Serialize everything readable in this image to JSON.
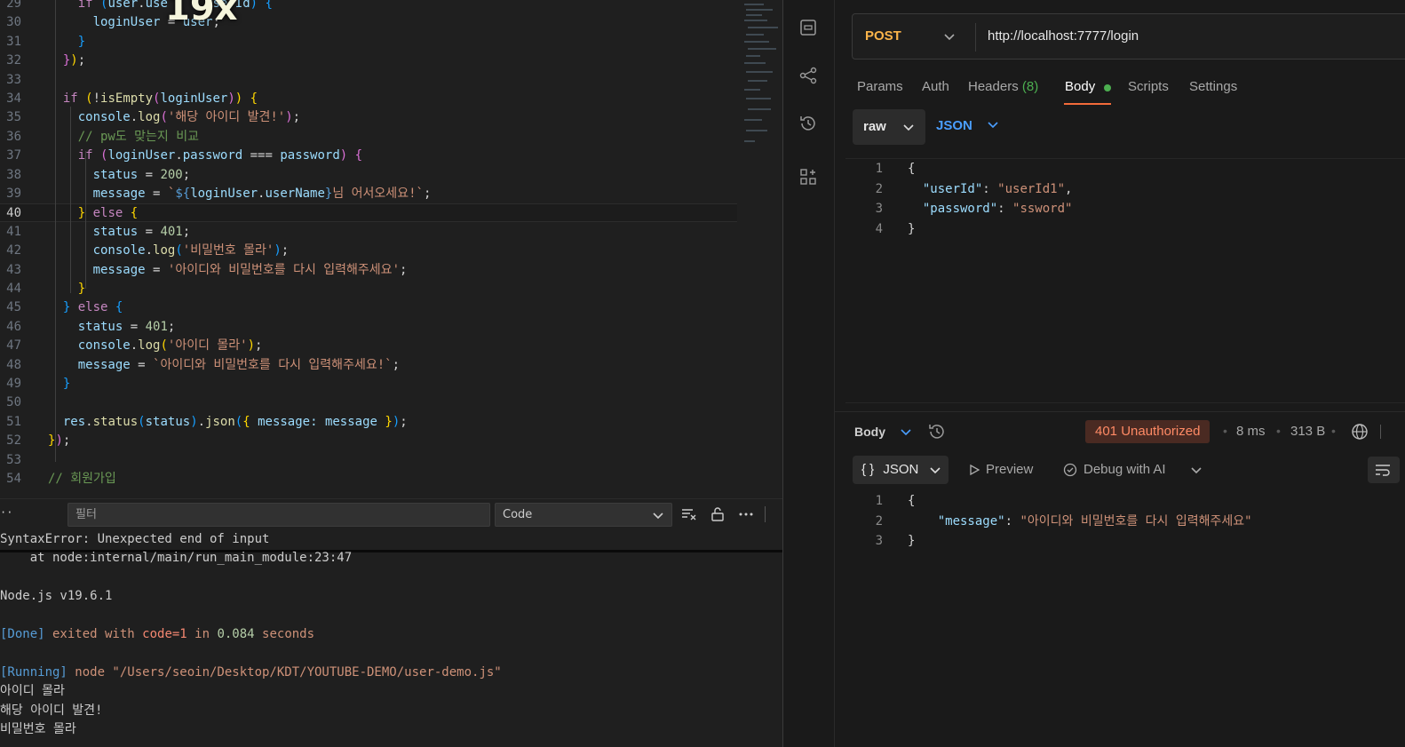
{
  "editor": {
    "overlay_text": "19x",
    "lines": [
      {
        "n": "29",
        "tokens": [
          [
            "    ",
            "pn"
          ],
          [
            "if",
            "kw"
          ],
          [
            " ",
            "pn"
          ],
          [
            "(",
            "b3"
          ],
          [
            "user",
            "var"
          ],
          [
            ".",
            "pn"
          ],
          [
            "use",
            "var"
          ],
          [
            "     ",
            "pn"
          ],
          [
            "userId",
            "var"
          ],
          [
            ")",
            "b3"
          ],
          [
            " ",
            "pn"
          ],
          [
            "{",
            "b3"
          ]
        ]
      },
      {
        "n": "30",
        "tokens": [
          [
            "      ",
            "pn"
          ],
          [
            "loginUser",
            "var"
          ],
          [
            " = ",
            "pn"
          ],
          [
            "user",
            "var"
          ],
          [
            ";",
            "pn"
          ]
        ]
      },
      {
        "n": "31",
        "tokens": [
          [
            "    ",
            "pn"
          ],
          [
            "}",
            "b3"
          ]
        ]
      },
      {
        "n": "32",
        "tokens": [
          [
            "  ",
            "pn"
          ],
          [
            "}",
            "b2"
          ],
          [
            ")",
            "b1"
          ],
          [
            ";",
            "pn"
          ]
        ]
      },
      {
        "n": "33",
        "tokens": []
      },
      {
        "n": "34",
        "tokens": [
          [
            "  ",
            "pn"
          ],
          [
            "if",
            "kw"
          ],
          [
            " ",
            "pn"
          ],
          [
            "(",
            "b1"
          ],
          [
            "!",
            "pn"
          ],
          [
            "isEmpty",
            "fn"
          ],
          [
            "(",
            "b2"
          ],
          [
            "loginUser",
            "var"
          ],
          [
            ")",
            "b2"
          ],
          [
            ")",
            "b1"
          ],
          [
            " ",
            "pn"
          ],
          [
            "{",
            "b1"
          ]
        ]
      },
      {
        "n": "35",
        "tokens": [
          [
            "    ",
            "pn"
          ],
          [
            "console",
            "var"
          ],
          [
            ".",
            "pn"
          ],
          [
            "log",
            "fn"
          ],
          [
            "(",
            "b2"
          ],
          [
            "'해당 아이디 발견!'",
            "str"
          ],
          [
            ")",
            "b2"
          ],
          [
            ";",
            "pn"
          ]
        ]
      },
      {
        "n": "36",
        "tokens": [
          [
            "    ",
            "pn"
          ],
          [
            "// pw도 맞는지 비교",
            "cm"
          ]
        ]
      },
      {
        "n": "37",
        "tokens": [
          [
            "    ",
            "pn"
          ],
          [
            "if",
            "kw"
          ],
          [
            " ",
            "pn"
          ],
          [
            "(",
            "b2"
          ],
          [
            "loginUser",
            "var"
          ],
          [
            ".",
            "pn"
          ],
          [
            "password",
            "var"
          ],
          [
            " === ",
            "pn"
          ],
          [
            "password",
            "var"
          ],
          [
            ")",
            "b2"
          ],
          [
            " ",
            "pn"
          ],
          [
            "{",
            "b2"
          ]
        ]
      },
      {
        "n": "38",
        "tokens": [
          [
            "      ",
            "pn"
          ],
          [
            "status",
            "var"
          ],
          [
            " = ",
            "pn"
          ],
          [
            "200",
            "num"
          ],
          [
            ";",
            "pn"
          ]
        ]
      },
      {
        "n": "39",
        "tokens": [
          [
            "      ",
            "pn"
          ],
          [
            "message",
            "var"
          ],
          [
            " = ",
            "pn"
          ],
          [
            "`",
            "str"
          ],
          [
            "${",
            "tpl"
          ],
          [
            "loginUser",
            "var"
          ],
          [
            ".",
            "pn"
          ],
          [
            "userName",
            "var"
          ],
          [
            "}",
            "tpl"
          ],
          [
            "님 어서오세요!`",
            "str"
          ],
          [
            ";",
            "pn"
          ]
        ]
      },
      {
        "n": "40",
        "current": true,
        "tokens": [
          [
            "    ",
            "pn"
          ],
          [
            "}",
            "b1"
          ],
          [
            " ",
            "pn"
          ],
          [
            "else",
            "kw"
          ],
          [
            " ",
            "pn"
          ],
          [
            "{",
            "b1"
          ]
        ]
      },
      {
        "n": "41",
        "tokens": [
          [
            "      ",
            "pn"
          ],
          [
            "status",
            "var"
          ],
          [
            " = ",
            "pn"
          ],
          [
            "401",
            "num"
          ],
          [
            ";",
            "pn"
          ]
        ]
      },
      {
        "n": "42",
        "tokens": [
          [
            "      ",
            "pn"
          ],
          [
            "console",
            "var"
          ],
          [
            ".",
            "pn"
          ],
          [
            "log",
            "fn"
          ],
          [
            "(",
            "b3"
          ],
          [
            "'비밀번호 몰라'",
            "str"
          ],
          [
            ")",
            "b3"
          ],
          [
            ";",
            "pn"
          ]
        ]
      },
      {
        "n": "43",
        "tokens": [
          [
            "      ",
            "pn"
          ],
          [
            "message",
            "var"
          ],
          [
            " = ",
            "pn"
          ],
          [
            "'아이디와 비밀번호를 다시 입력해주세요'",
            "str"
          ],
          [
            ";",
            "pn"
          ]
        ]
      },
      {
        "n": "44",
        "tokens": [
          [
            "    ",
            "pn"
          ],
          [
            "}",
            "b1"
          ]
        ]
      },
      {
        "n": "45",
        "tokens": [
          [
            "  ",
            "pn"
          ],
          [
            "}",
            "b3"
          ],
          [
            " ",
            "pn"
          ],
          [
            "else",
            "kw"
          ],
          [
            " ",
            "pn"
          ],
          [
            "{",
            "b3"
          ]
        ]
      },
      {
        "n": "46",
        "tokens": [
          [
            "    ",
            "pn"
          ],
          [
            "status",
            "var"
          ],
          [
            " = ",
            "pn"
          ],
          [
            "401",
            "num"
          ],
          [
            ";",
            "pn"
          ]
        ]
      },
      {
        "n": "47",
        "tokens": [
          [
            "    ",
            "pn"
          ],
          [
            "console",
            "var"
          ],
          [
            ".",
            "pn"
          ],
          [
            "log",
            "fn"
          ],
          [
            "(",
            "b1"
          ],
          [
            "'아이디 몰라'",
            "str"
          ],
          [
            ")",
            "b1"
          ],
          [
            ";",
            "pn"
          ]
        ]
      },
      {
        "n": "48",
        "tokens": [
          [
            "    ",
            "pn"
          ],
          [
            "message",
            "var"
          ],
          [
            " = ",
            "pn"
          ],
          [
            "`아이디와 비밀번호를 다시 입력해주세요!`",
            "str"
          ],
          [
            ";",
            "pn"
          ]
        ]
      },
      {
        "n": "49",
        "tokens": [
          [
            "  ",
            "pn"
          ],
          [
            "}",
            "b3"
          ]
        ]
      },
      {
        "n": "50",
        "tokens": []
      },
      {
        "n": "51",
        "tokens": [
          [
            "  ",
            "pn"
          ],
          [
            "res",
            "var"
          ],
          [
            ".",
            "pn"
          ],
          [
            "status",
            "fn"
          ],
          [
            "(",
            "b3"
          ],
          [
            "status",
            "var"
          ],
          [
            ")",
            "b3"
          ],
          [
            ".",
            "pn"
          ],
          [
            "json",
            "fn"
          ],
          [
            "(",
            "b3"
          ],
          [
            "{",
            "b1"
          ],
          [
            " message: ",
            "var"
          ],
          [
            "message",
            "var"
          ],
          [
            " ",
            "pn"
          ],
          [
            "}",
            "b1"
          ],
          [
            ")",
            "b3"
          ],
          [
            ";",
            "pn"
          ]
        ]
      },
      {
        "n": "52",
        "tokens": [
          [
            "}",
            "b1"
          ],
          [
            ")",
            "b2"
          ],
          [
            ";",
            "pn"
          ]
        ]
      },
      {
        "n": "53",
        "tokens": []
      },
      {
        "n": "54",
        "tokens": [
          [
            "// 회원가입",
            "cm"
          ]
        ]
      }
    ]
  },
  "output_panel": {
    "filter_placeholder": "필터",
    "selected_channel": "Code",
    "lines": [
      {
        "parts": [
          [
            "SyntaxError: Unexpected end of input",
            ""
          ]
        ]
      },
      {
        "parts": [
          [
            "    at node:internal/main/run_main_module:23:47",
            ""
          ]
        ]
      },
      {
        "parts": []
      },
      {
        "parts": [
          [
            "Node.js v19.6.1",
            ""
          ]
        ]
      },
      {
        "parts": []
      },
      {
        "parts": [
          [
            "[Done]",
            "out-blue"
          ],
          [
            " exited with ",
            "out-str"
          ],
          [
            "code=1",
            "out-red"
          ],
          [
            " in ",
            "out-str"
          ],
          [
            "0.084",
            "out-green"
          ],
          [
            " seconds",
            "out-str"
          ]
        ]
      },
      {
        "parts": []
      },
      {
        "parts": [
          [
            "[Running]",
            "out-blue"
          ],
          [
            " node \"/Users/seoin/Desktop/KDT/YOUTUBE-DEMO/user-demo.js\"",
            "out-str"
          ]
        ]
      },
      {
        "parts": [
          [
            "아이디 몰라",
            ""
          ]
        ]
      },
      {
        "parts": [
          [
            "해당 아이디 발견!",
            ""
          ]
        ]
      },
      {
        "parts": [
          [
            "비밀번호 몰라",
            ""
          ]
        ]
      }
    ]
  },
  "request": {
    "method": "POST",
    "url": "http://localhost:7777/login",
    "tabs": [
      {
        "label": "Params"
      },
      {
        "label": "Auth"
      },
      {
        "label": "Headers",
        "count": "(8)"
      },
      {
        "label": "Body",
        "active": true
      },
      {
        "label": "Scripts"
      },
      {
        "label": "Settings"
      }
    ],
    "body_mode": "raw",
    "body_type": "JSON",
    "body_lines": [
      {
        "n": "1",
        "parts": [
          [
            "{",
            "pn"
          ]
        ]
      },
      {
        "n": "2",
        "parts": [
          [
            "  ",
            "pn"
          ],
          [
            "\"userId\"",
            "jkey"
          ],
          [
            ": ",
            "pn"
          ],
          [
            "\"userId1\"",
            "jstr"
          ],
          [
            ",",
            "pn"
          ]
        ]
      },
      {
        "n": "3",
        "parts": [
          [
            "  ",
            "pn"
          ],
          [
            "\"password\"",
            "jkey"
          ],
          [
            ": ",
            "pn"
          ],
          [
            "\"ssword\"",
            "jstr"
          ]
        ]
      },
      {
        "n": "4",
        "parts": [
          [
            "}",
            "pn"
          ]
        ]
      }
    ]
  },
  "response": {
    "body_label": "Body",
    "status": "401 Unauthorized",
    "time": "8 ms",
    "size": "313 B",
    "format": "JSON",
    "preview_label": "Preview",
    "debug_label": "Debug with AI",
    "lines": [
      {
        "n": "1",
        "parts": [
          [
            "{",
            "pn"
          ]
        ]
      },
      {
        "n": "2",
        "parts": [
          [
            "    ",
            "pn"
          ],
          [
            "\"message\"",
            "jkey"
          ],
          [
            ": ",
            "pn"
          ],
          [
            "\"아이디와 비밀번호를 다시 입력해주세요\"",
            "jstr"
          ]
        ]
      },
      {
        "n": "3",
        "parts": [
          [
            "}",
            "pn"
          ]
        ]
      }
    ]
  },
  "colors": {
    "method": "#fbb44a",
    "status_badge_text": "#ff8a65",
    "status_badge_bg": "#4a2a22",
    "active_tab_underline": "#f26b3a",
    "body_dot": "#4caf50"
  },
  "icons": [
    "collection-icon",
    "flow-icon",
    "history-icon",
    "apps-icon",
    "chevron-down-icon",
    "clear-output-icon",
    "lock-icon",
    "more-icon",
    "globe-icon",
    "wrap-icon",
    "play-icon",
    "ai-debug-icon"
  ]
}
